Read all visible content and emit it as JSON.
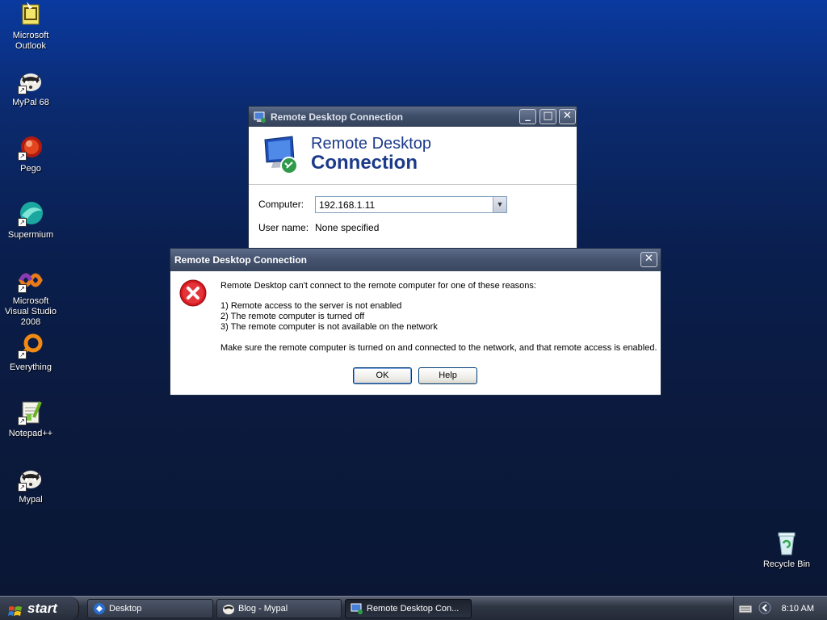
{
  "desktop": {
    "icons": [
      {
        "label": "Microsoft Outlook",
        "icon": "outlook-icon"
      },
      {
        "label": "MyPal 68",
        "icon": "mypal-icon"
      },
      {
        "label": "Pego",
        "icon": "pego-icon"
      },
      {
        "label": "Supermium",
        "icon": "supermium-icon"
      },
      {
        "label": "Microsoft Visual Studio 2008",
        "icon": "visual-studio-icon"
      },
      {
        "label": "Everything",
        "icon": "everything-icon"
      },
      {
        "label": "Notepad++",
        "icon": "notepadpp-icon"
      },
      {
        "label": "Mypal",
        "icon": "mypal-icon"
      }
    ],
    "recycle_bin": {
      "label": "Recycle Bin",
      "icon": "recycle-bin-icon"
    }
  },
  "rdc_window": {
    "title": "Remote Desktop Connection",
    "banner_line1": "Remote Desktop",
    "banner_line2": "Connection",
    "computer_label": "Computer:",
    "computer_value": "192.168.1.11",
    "username_label": "User name:",
    "username_value": "None specified",
    "minimize": "_",
    "maximize": "□",
    "close": "✕"
  },
  "error_dialog": {
    "title": "Remote Desktop Connection",
    "close": "✕",
    "intro": "Remote Desktop can't connect to the remote computer for one of these reasons:",
    "reasons": [
      "1) Remote access to the server is not enabled",
      "2) The remote computer is turned off",
      "3) The remote computer is not available on the network"
    ],
    "advice": "Make sure the remote computer is turned on and connected to the network, and that remote access is enabled.",
    "ok_label": "OK",
    "help_label": "Help"
  },
  "taskbar": {
    "start_label": "start",
    "tasks": [
      {
        "label": "Desktop"
      },
      {
        "label": "Blog - Mypal"
      },
      {
        "label": "Remote Desktop Con..."
      }
    ],
    "clock": "8:10 AM"
  },
  "colors": {
    "desktop_top": "#0a3aa0",
    "desktop_bottom": "#0a1633",
    "title_text_blue": "#1c3a8a",
    "error_red": "#d7181e"
  }
}
